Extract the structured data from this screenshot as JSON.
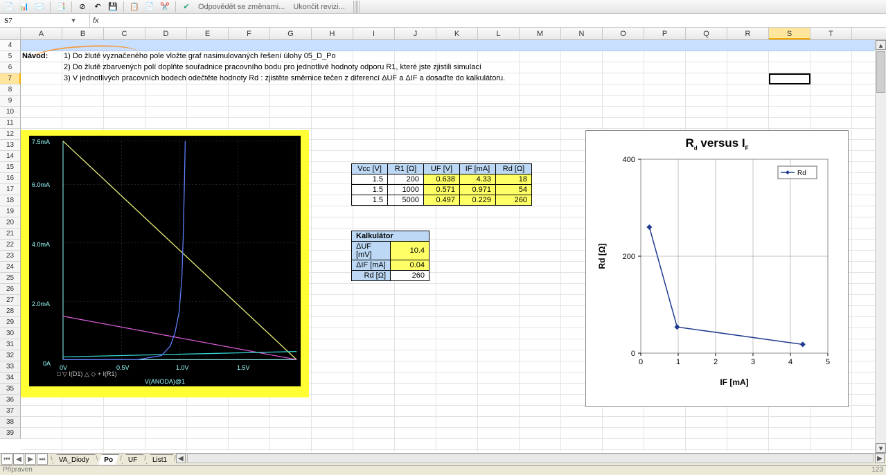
{
  "toolbar": {
    "reply_label": "Odpovědět se změnami...",
    "end_revision_label": "Ukončit revizi..."
  },
  "namebox": "S7",
  "fx_symbol": "fx",
  "columns": [
    "A",
    "B",
    "C",
    "D",
    "E",
    "F",
    "G",
    "H",
    "I",
    "J",
    "K",
    "L",
    "M",
    "N",
    "O",
    "P",
    "Q",
    "R",
    "S",
    "T"
  ],
  "row_first": 4,
  "row_last": 39,
  "navod_label": "Návod:",
  "instructions": [
    "1) Do žlutě vyznačeného pole vložte graf nasimulovaných řešení úlohy 05_D_Po",
    "2) Do žlutě zbarvených polí doplňte souřadnice pracovního bodu pro jednotlivé hodnoty odporu R1, které jste zjistili simulací",
    "3) V jednotlivých pracovních bodech odečtěte hodnoty Rd : zjistěte směrnice tečen z diferencí ΔUF a ΔIF a dosaďte do kalkulátoru."
  ],
  "data_table": {
    "headers": [
      "Vcc  [V]",
      "R1 [Ω]",
      "UF   [V]",
      "IF   [mA]",
      "Rd [Ω]"
    ],
    "rows": [
      {
        "vcc": "1.5",
        "r1": "200",
        "uf": "0.638",
        "if": "4.33",
        "rd": "18"
      },
      {
        "vcc": "1.5",
        "r1": "1000",
        "uf": "0.571",
        "if": "0.971",
        "rd": "54"
      },
      {
        "vcc": "1.5",
        "r1": "5000",
        "uf": "0.497",
        "if": "0.229",
        "rd": "260"
      }
    ]
  },
  "kalkulator": {
    "title": "Kalkulátor",
    "du_label": "ΔUF [mV]",
    "du": "10.4",
    "di_label": "ΔIF [mA]",
    "di": "0.04",
    "rd_label": "Rd [Ω]",
    "rd": "260"
  },
  "pspice": {
    "y_ticks": [
      "7.5mA",
      "6.0mA",
      "4.0mA",
      "2.0mA",
      "0A"
    ],
    "x_ticks": [
      "0V",
      "0.5V",
      "1.0V",
      "1.5V"
    ],
    "x_title": "V(ANODA)@1",
    "legend": "□ ▽ I(D1)  △ ◇ + I(R1)"
  },
  "chart_data": {
    "type": "line",
    "title": "Rd versus IF",
    "xlabel": "IF  [mA]",
    "ylabel": "Rd [Ω]",
    "xlim": [
      0,
      5
    ],
    "ylim": [
      0,
      400
    ],
    "x_ticks": [
      0,
      1,
      2,
      3,
      4,
      5
    ],
    "y_ticks": [
      0,
      200,
      400
    ],
    "series": [
      {
        "name": "Rd",
        "x": [
          0.229,
          0.971,
          4.33
        ],
        "y": [
          260,
          54,
          18
        ]
      }
    ],
    "legend_position": "top-right"
  },
  "sheet_tabs": [
    "VA_Diody",
    "Po",
    "UF",
    "List1"
  ],
  "active_tab": "Po",
  "status_left": "Připraven",
  "status_right": "123"
}
